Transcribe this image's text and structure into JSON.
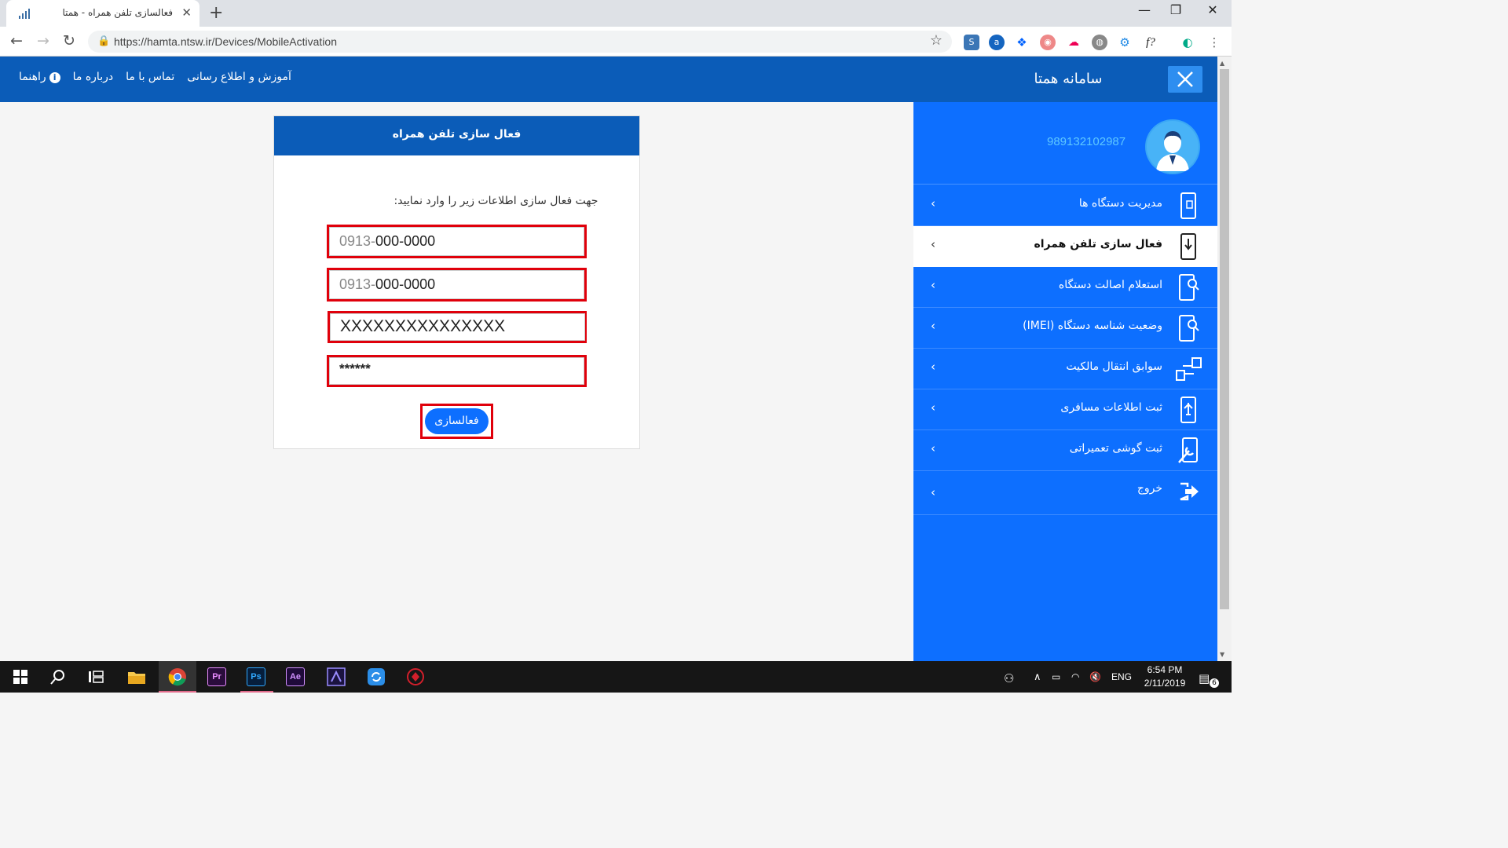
{
  "browser": {
    "tab_title": "فعالسازی تلفن همراه - همتا",
    "url": "https://hamta.ntsw.ir/Devices/MobileActivation"
  },
  "header": {
    "site_title": "سامانه همتا",
    "links": [
      "راهنما",
      "درباره ما",
      "تماس با ما",
      "آموزش و اطلاع رسانی"
    ]
  },
  "sidebar": {
    "phone_number": "989132102987",
    "items": [
      {
        "label": "مدیریت دستگاه ها",
        "icon": "phone-manage-icon"
      },
      {
        "label": "فعال سازی تلفن همراه",
        "icon": "phone-activate-icon",
        "active": true
      },
      {
        "label": "استعلام اصالت دستگاه",
        "icon": "phone-search-icon"
      },
      {
        "label": "وضعیت شناسه دستگاه (IMEI)",
        "icon": "phone-imei-icon"
      },
      {
        "label": "سوابق انتقال مالکیت",
        "icon": "transfer-icon"
      },
      {
        "label": "ثبت اطلاعات مسافری",
        "icon": "travel-icon"
      },
      {
        "label": "ثبت گوشی تعمیراتی",
        "icon": "repair-icon"
      },
      {
        "label": "خروج",
        "icon": "logout-icon"
      }
    ]
  },
  "card": {
    "title": "فعال سازی تلفن همراه",
    "hint": "جهت فعال سازی اطلاعات زیر را وارد نمایید:",
    "field1_prefix": "0913-",
    "field1_value": "000-0000",
    "field2_prefix": "0913-",
    "field2_value": "000-0000",
    "field3_value": "XXXXXXXXXXXXXXX",
    "field4_value": "******",
    "submit_label": "فعالسازی"
  },
  "taskbar": {
    "apps": [
      "Pr",
      "Ps",
      "Ae"
    ],
    "lang": "ENG",
    "time": "6:54 PM",
    "date": "2/11/2019",
    "notification_count": "6"
  }
}
